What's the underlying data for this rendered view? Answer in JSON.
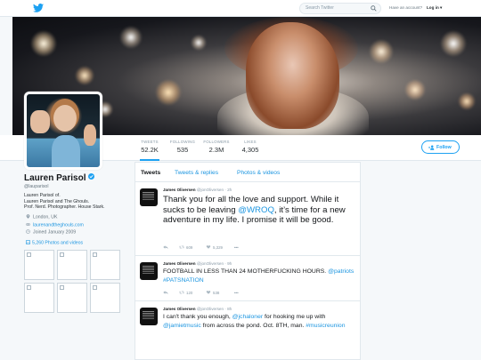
{
  "nav": {
    "search_placeholder": "Search Twitter",
    "have_account": "Have an account?",
    "login": "Log in ▾"
  },
  "stats": [
    {
      "label": "TWEETS",
      "value": "52.2K"
    },
    {
      "label": "FOLLOWING",
      "value": "535"
    },
    {
      "label": "FOLLOWERS",
      "value": "2.3M"
    },
    {
      "label": "LIKES",
      "value": "4,305"
    }
  ],
  "follow_label": "Follow",
  "profile": {
    "name": "Lauren Parisol",
    "handle": "@lauparisol",
    "bio_lines": [
      "Lauren Parisol of.",
      "Lauren Parisol and The Ghouls.",
      "Prof. Nerd. Photographer. House Stark."
    ],
    "location": "London, UK",
    "url": "laurenandtheghouls.com",
    "joined": "Joined January 2009",
    "photos_link": "5,260 Photos and videos"
  },
  "tabs": [
    "Tweets",
    "Tweets & replies",
    "Photos & videos"
  ],
  "tweets": [
    {
      "author": "James Oliversen",
      "handle": "@jonOliversen",
      "time": "2h",
      "segments": [
        {
          "t": "Thank you for all the love and support. While it sucks to be leaving ",
          "link": false
        },
        {
          "t": "@WROQ",
          "link": true
        },
        {
          "t": ", it’s time for a new adventure in my life. I promise it will be good.",
          "link": false
        }
      ],
      "retweets": "609",
      "likes": "5,329",
      "more": "•••"
    },
    {
      "author": "James Oliversen",
      "handle": "@jonOliversen",
      "time": "9h",
      "segments": [
        {
          "t": "FOOTBALL IN LESS THAN 24 MOTHERFUCKING HOURS. ",
          "link": false
        },
        {
          "t": "@patriots #PATSNATION",
          "link": true
        }
      ],
      "retweets": "120",
      "likes": "538",
      "more": "•••"
    },
    {
      "author": "James Oliversen",
      "handle": "@jonOliversen",
      "time": "8h",
      "segments": [
        {
          "t": "I can't thank you enough, ",
          "link": false
        },
        {
          "t": "@jchaloner",
          "link": true
        },
        {
          "t": " for hooking me up with ",
          "link": false
        },
        {
          "t": "@jamietmusic",
          "link": true
        },
        {
          "t": " from across the pond. Oct. 8TH, man. ",
          "link": false
        },
        {
          "t": "#musicreunion",
          "link": true
        }
      ],
      "retweets": "",
      "likes": "",
      "more": ""
    }
  ],
  "colors": {
    "accent": "#1da1f2",
    "link": "#1b95e0",
    "background": "#f5f8fa"
  }
}
